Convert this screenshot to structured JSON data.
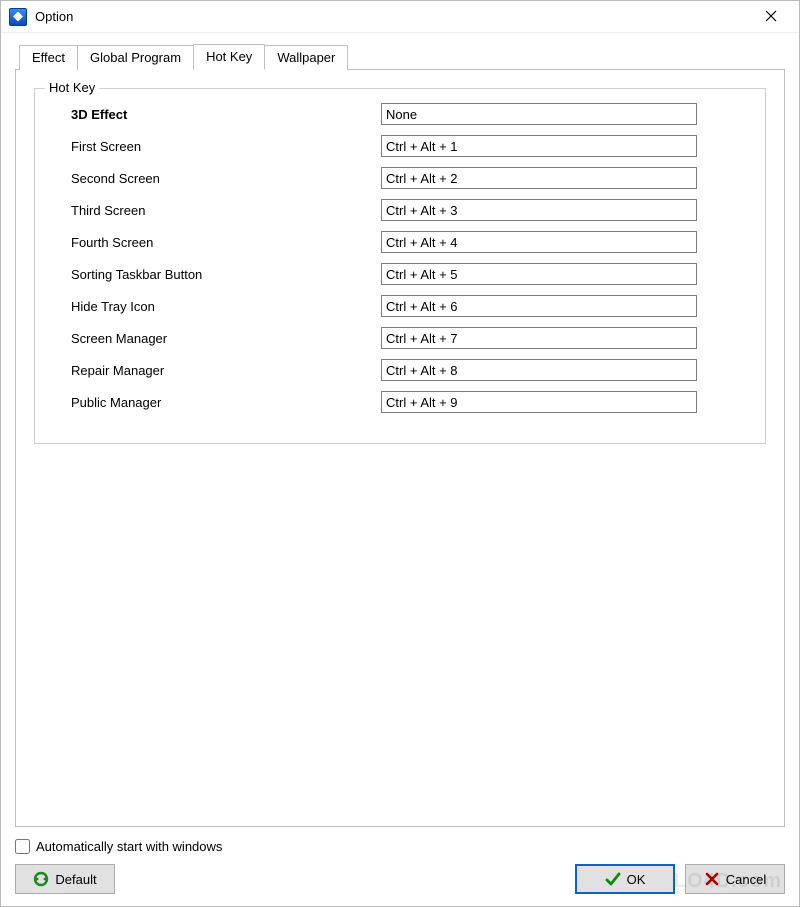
{
  "window": {
    "title": "Option"
  },
  "tabs": {
    "effect": "Effect",
    "global_program": "Global Program",
    "hot_key": "Hot Key",
    "wallpaper": "Wallpaper",
    "active": "hot_key"
  },
  "groupbox": {
    "legend": "Hot Key"
  },
  "hotkeys": [
    {
      "label": "3D Effect",
      "value": "None",
      "bold": true,
      "focused": true
    },
    {
      "label": "First Screen",
      "value": "Ctrl + Alt + 1"
    },
    {
      "label": "Second Screen",
      "value": "Ctrl + Alt + 2"
    },
    {
      "label": "Third Screen",
      "value": "Ctrl + Alt + 3"
    },
    {
      "label": "Fourth Screen",
      "value": "Ctrl + Alt + 4"
    },
    {
      "label": "Sorting Taskbar Button",
      "value": "Ctrl + Alt + 5"
    },
    {
      "label": "Hide Tray Icon",
      "value": "Ctrl + Alt + 6"
    },
    {
      "label": "Screen Manager",
      "value": "Ctrl + Alt + 7"
    },
    {
      "label": "Repair Manager",
      "value": "Ctrl + Alt + 8"
    },
    {
      "label": "Public Manager",
      "value": "Ctrl + Alt + 9"
    }
  ],
  "autostart": {
    "label": "Automatically start with windows",
    "checked": false
  },
  "buttons": {
    "default": "Default",
    "ok": "OK",
    "cancel": "Cancel"
  },
  "watermark": "LO4D.com"
}
